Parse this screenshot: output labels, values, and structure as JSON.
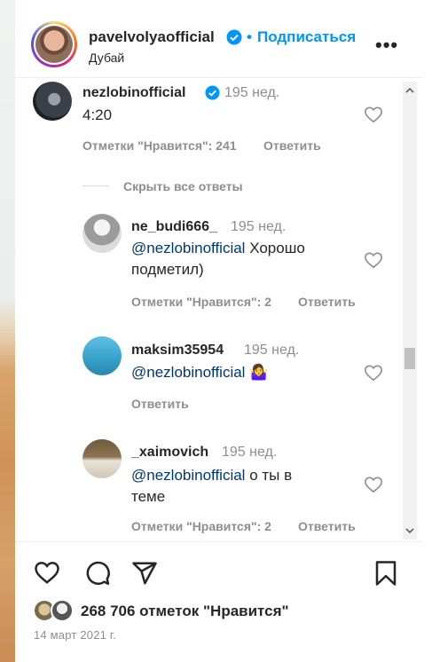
{
  "header": {
    "username": "pavelvolyaofficial",
    "separator": "•",
    "follow_label": "Подписаться",
    "location": "Дубай",
    "more_label": "•••"
  },
  "comments": {
    "root": {
      "user": "nezlobinofficial",
      "time": "195 нед.",
      "text": "4:20",
      "likes": "Отметки \"Нравится\": 241",
      "reply": "Ответить"
    },
    "hide_replies": "Скрыть все ответы",
    "replies": [
      {
        "user": "ne_budi666_",
        "time": "195 нед.",
        "mention": "@nezlobinofficial",
        "text_line1": " Хорошо",
        "text_line2": "подметил)",
        "likes": "Отметки \"Нравится\": 2",
        "reply": "Ответить"
      },
      {
        "user": "maksim35954",
        "time": "195 нед.",
        "mention": "@nezlobinofficial",
        "emoji": "🤷‍♀️",
        "reply": "Ответить"
      },
      {
        "user": "_xaimovich",
        "time": "195 нед.",
        "mention": "@nezlobinofficial",
        "text_line1": " о ты в",
        "text_line2": "теме",
        "likes": "Отметки \"Нравится\": 2",
        "reply": "Ответить"
      }
    ]
  },
  "footer": {
    "likes_count": "268 706 отметок \"Нравится\"",
    "date": "14 март 2021 г."
  },
  "colors": {
    "accent": "#0095f6",
    "mention": "#00376b",
    "muted": "#8e8e8e",
    "text": "#262626"
  },
  "icons": [
    "verified-badge-icon",
    "more-icon",
    "heart-icon",
    "comment-icon",
    "share-icon",
    "bookmark-icon"
  ]
}
